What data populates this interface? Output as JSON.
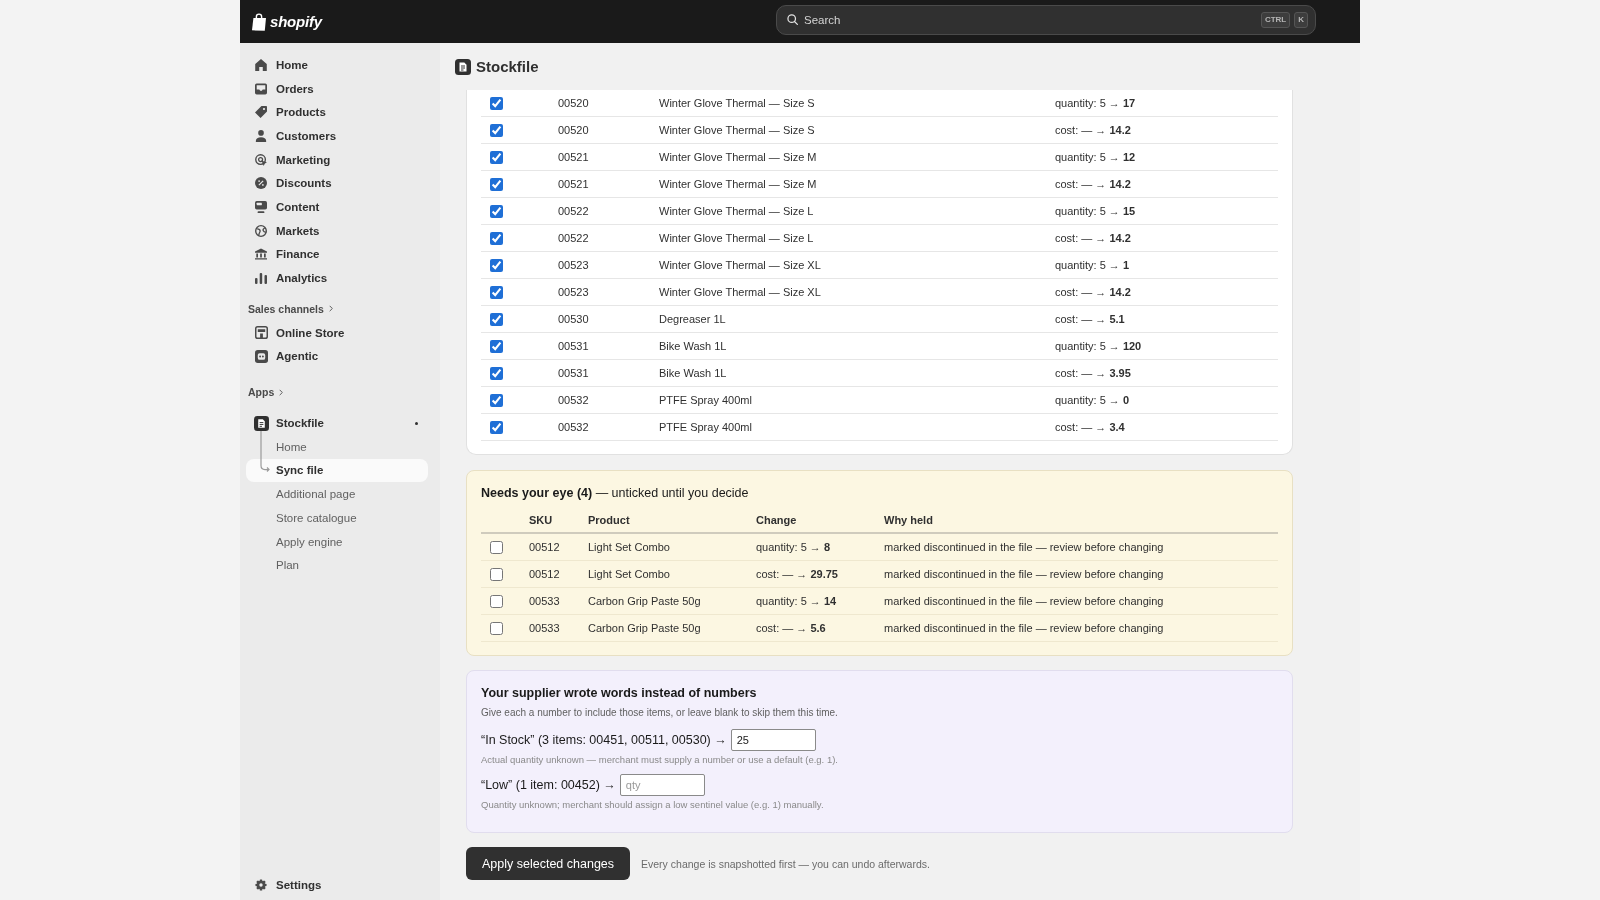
{
  "top_bar": {
    "brand": "shopify",
    "search": {
      "placeholder": "Search",
      "shortcut": [
        "CTRL",
        "K"
      ]
    }
  },
  "sidebar": {
    "items": [
      {
        "label": "Home",
        "selected": false
      },
      {
        "label": "Orders",
        "selected": false
      },
      {
        "label": "Products",
        "selected": false
      },
      {
        "label": "Customers",
        "selected": false
      },
      {
        "label": "Marketing",
        "selected": false
      },
      {
        "label": "Discounts",
        "selected": false
      },
      {
        "label": "Content",
        "selected": false
      },
      {
        "label": "Markets",
        "selected": false
      },
      {
        "label": "Finance",
        "selected": false
      },
      {
        "label": "Analytics",
        "selected": false
      }
    ],
    "sections": [
      {
        "title": "Sales channels",
        "items": [
          {
            "label": "Online Store",
            "selected": false
          },
          {
            "label": "Agentic",
            "selected": false
          }
        ]
      },
      {
        "title": "Apps",
        "items": [
          {
            "label": "Stockfile",
            "selected": false,
            "children": [
              {
                "label": "Home",
                "selected": false
              },
              {
                "label": "Sync file",
                "selected": true
              },
              {
                "label": "Additional page",
                "selected": false
              },
              {
                "label": "Store catalogue",
                "selected": false
              },
              {
                "label": "Apply engine",
                "selected": false
              },
              {
                "label": "Plan",
                "selected": false
              }
            ]
          }
        ]
      }
    ],
    "footer_item": {
      "label": "Settings",
      "selected": false
    }
  },
  "page": {
    "title": "Stockfile"
  },
  "changes_table": {
    "rows": [
      {
        "checked": true,
        "cells": [
          "00520",
          "Winter Glove Thermal — Size S",
          "quantity: 5 → **17**"
        ]
      },
      {
        "checked": true,
        "cells": [
          "00520",
          "Winter Glove Thermal — Size S",
          "cost: — → **14.2**"
        ]
      },
      {
        "checked": true,
        "cells": [
          "00521",
          "Winter Glove Thermal — Size M",
          "quantity: 5 → **12**"
        ]
      },
      {
        "checked": true,
        "cells": [
          "00521",
          "Winter Glove Thermal — Size M",
          "cost: — → **14.2**"
        ]
      },
      {
        "checked": true,
        "cells": [
          "00522",
          "Winter Glove Thermal — Size L",
          "quantity: 5 → **15**"
        ]
      },
      {
        "checked": true,
        "cells": [
          "00522",
          "Winter Glove Thermal — Size L",
          "cost: — → **14.2**"
        ]
      },
      {
        "checked": true,
        "cells": [
          "00523",
          "Winter Glove Thermal — Size XL",
          "quantity: 5 → **1**"
        ]
      },
      {
        "checked": true,
        "cells": [
          "00523",
          "Winter Glove Thermal — Size XL",
          "cost: — → **14.2**"
        ]
      },
      {
        "checked": true,
        "cells": [
          "00530",
          "Degreaser 1L",
          "cost: — → **5.1**"
        ]
      },
      {
        "checked": true,
        "cells": [
          "00531",
          "Bike Wash 1L",
          "quantity: 5 → **120**"
        ]
      },
      {
        "checked": true,
        "cells": [
          "00531",
          "Bike Wash 1L",
          "cost: — → **3.95**"
        ]
      },
      {
        "checked": true,
        "cells": [
          "00532",
          "PTFE Spray 400ml",
          "quantity: 5 → **0**"
        ]
      },
      {
        "checked": true,
        "cells": [
          "00532",
          "PTFE Spray 400ml",
          "cost: — → **3.4**"
        ]
      }
    ]
  },
  "review_panel": {
    "heading": "**Needs your eye (4)** — unticked until you decide",
    "columns": [
      "SKU",
      "Product",
      "Change",
      "Why held"
    ],
    "rows": [
      {
        "checked": false,
        "cells": [
          "00512",
          "Light Set Combo",
          "quantity: 5 → **8**",
          "marked discontinued in the file — review before changing"
        ]
      },
      {
        "checked": false,
        "cells": [
          "00512",
          "Light Set Combo",
          "cost: — → **29.75**",
          "marked discontinued in the file — review before changing"
        ]
      },
      {
        "checked": false,
        "cells": [
          "00533",
          "Carbon Grip Paste 50g",
          "quantity: 5 → **14**",
          "marked discontinued in the file — review before changing"
        ]
      },
      {
        "checked": false,
        "cells": [
          "00533",
          "Carbon Grip Paste 50g",
          "cost: — → **5.6**",
          "marked discontinued in the file — review before changing"
        ]
      }
    ]
  },
  "word_values_panel": {
    "title": "Your supplier wrote words instead of numbers",
    "description": "Give each a number to include those items, or leave blank to skip them this time.",
    "entries": [
      {
        "label": "“In Stock” (3 items: 00451, 00511, 00530) →",
        "value": "25",
        "note": "Actual quantity unknown — merchant must supply a number or use a default (e.g. 1)."
      },
      {
        "label": "“Low” (1 item: 00452) →",
        "placeholder": "qty",
        "note": "Quantity unknown; merchant should assign a low sentinel value (e.g. 1) manually."
      }
    ]
  },
  "footer": {
    "button": "Apply selected changes",
    "note": "Every change is snapshotted first — you can undo afterwards."
  }
}
